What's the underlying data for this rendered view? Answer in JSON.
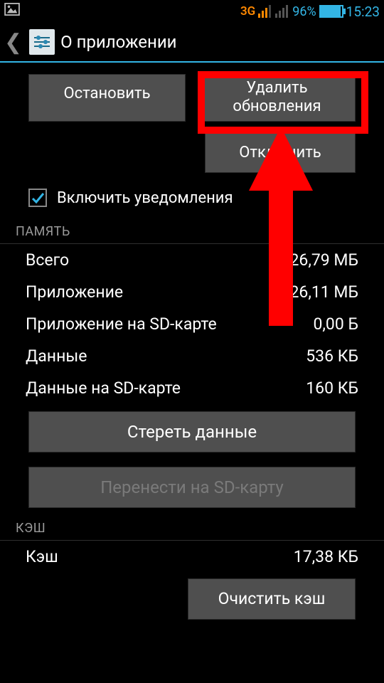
{
  "status": {
    "network_label": "3G",
    "battery_pct": "96%",
    "clock": "15:23"
  },
  "header": {
    "title": "О приложении"
  },
  "buttons": {
    "stop": "Остановить",
    "delete_updates": "Удалить обновления",
    "disable": "Отключить",
    "clear_data": "Стереть данные",
    "move_to_sd": "Перенести на SD-карту",
    "clear_cache": "Очистить кэш"
  },
  "checkbox": {
    "enable_notifications": "Включить уведомления"
  },
  "sections": {
    "memory": "ПАМЯТЬ",
    "cache": "КЭШ"
  },
  "memory": {
    "rows": [
      {
        "label": "Всего",
        "value": "26,79 МБ"
      },
      {
        "label": "Приложение",
        "value": "26,11 МБ"
      },
      {
        "label": "Приложение на SD-карте",
        "value": "0,00 Б"
      },
      {
        "label": "Данные",
        "value": "536 КБ"
      },
      {
        "label": "Данные на SD-карте",
        "value": "160 КБ"
      }
    ]
  },
  "cache": {
    "label": "Кэш",
    "value": "17,38 КБ"
  },
  "annotation": {
    "highlight_target": "delete-updates-button",
    "arrow_direction": "up"
  }
}
